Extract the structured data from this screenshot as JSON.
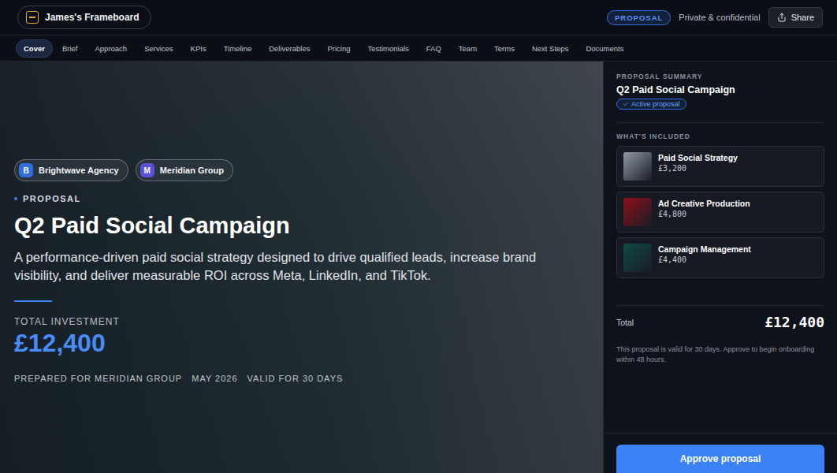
{
  "topbar": {
    "brand": "James's Frameboard",
    "badge": "PROPOSAL",
    "privacy": "Private & confidential",
    "share": "Share"
  },
  "nav": [
    {
      "label": "Cover",
      "selected": true
    },
    {
      "label": "Brief",
      "selected": false
    },
    {
      "label": "Approach",
      "selected": false
    },
    {
      "label": "Services",
      "selected": false
    },
    {
      "label": "KPIs",
      "selected": false
    },
    {
      "label": "Timeline",
      "selected": false
    },
    {
      "label": "Deliverables",
      "selected": false
    },
    {
      "label": "Pricing",
      "selected": false
    },
    {
      "label": "Testimonials",
      "selected": false
    },
    {
      "label": "FAQ",
      "selected": false
    },
    {
      "label": "Team",
      "selected": false
    },
    {
      "label": "Terms",
      "selected": false
    },
    {
      "label": "Next Steps",
      "selected": false
    },
    {
      "label": "Documents",
      "selected": false
    }
  ],
  "hero": {
    "parties": [
      {
        "initial": "B",
        "name": "Brightwave Agency",
        "color": "#2f6fe0"
      },
      {
        "initial": "M",
        "name": "Meridian Group",
        "color": "#5b4fd6"
      }
    ],
    "eyebrow": "PROPOSAL",
    "title": "Q2 Paid Social Campaign",
    "description": "A performance-driven paid social strategy designed to drive qualified leads, increase brand visibility, and deliver measurable ROI across Meta, LinkedIn, and TikTok.",
    "investment_label": "TOTAL INVESTMENT",
    "investment": "£12,400",
    "meta": [
      "PREPARED FOR MERIDIAN GROUP",
      "MAY 2026",
      "VALID FOR 30 DAYS"
    ]
  },
  "sidebar": {
    "eyebrow": "PROPOSAL SUMMARY",
    "title": "Q2 Paid Social Campaign",
    "status": "Active proposal",
    "included_label": "WHAT'S INCLUDED",
    "items": [
      {
        "name": "Paid Social Strategy",
        "price": "£3,200",
        "color": "#8e9aa6"
      },
      {
        "name": "Ad Creative Production",
        "price": "£4,800",
        "color": "#8f1018"
      },
      {
        "name": "Campaign Management",
        "price": "£4,400",
        "color": "#0f4a46"
      }
    ],
    "total_label": "Total",
    "total": "£12,400",
    "note": "This proposal is valid for 30 days. Approve to begin onboarding within 48 hours.",
    "button": "Approve proposal"
  }
}
